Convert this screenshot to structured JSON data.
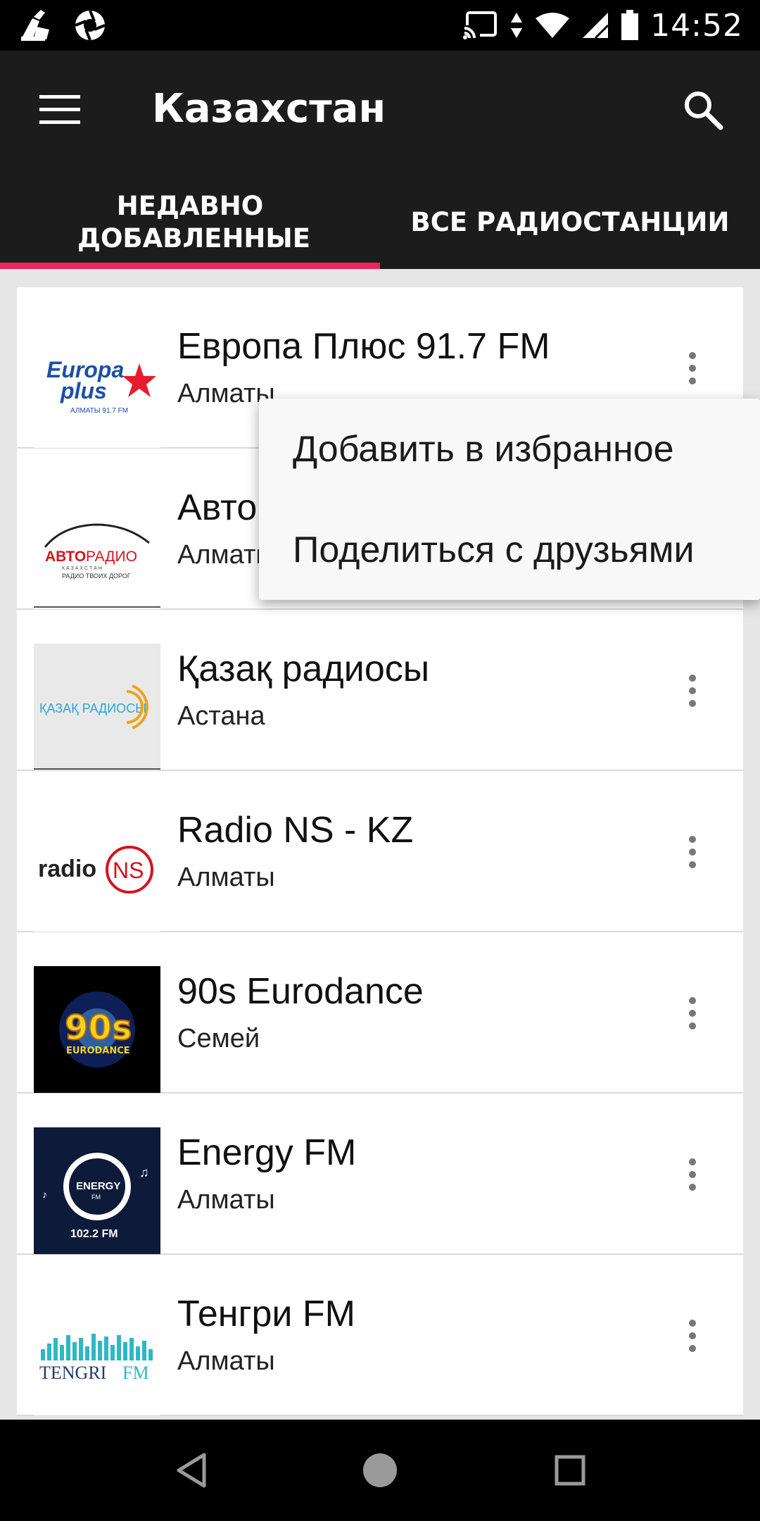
{
  "status": {
    "time": "14:52"
  },
  "app_bar": {
    "title": "Казахстан"
  },
  "tabs": [
    {
      "label": "НЕДАВНО ДОБАВЛЕННЫЕ",
      "active": true
    },
    {
      "label": "ВСЕ РАДИОСТАНЦИИ",
      "active": false
    }
  ],
  "stations": [
    {
      "name": "Европа Плюс 91.7 FM",
      "city": "Алматы",
      "logo": "europa-plus-logo"
    },
    {
      "name": "Авторадио",
      "city": "Алматы",
      "logo": "avtoradio-logo"
    },
    {
      "name": "Қазақ радиосы",
      "city": "Астана",
      "logo": "kazakh-radio-logo"
    },
    {
      "name": "Radio NS - KZ",
      "city": "Алматы",
      "logo": "radio-ns-logo"
    },
    {
      "name": "90s Eurodance",
      "city": "Семей",
      "logo": "90s-eurodance-logo"
    },
    {
      "name": "Energy FM",
      "city": "Алматы",
      "logo": "energy-fm-logo"
    },
    {
      "name": "Тенгри FM",
      "city": "Алматы",
      "logo": "tengri-fm-logo"
    }
  ],
  "logo_text": {
    "europa_1": "Europa",
    "europa_2": "plus",
    "europa_3": "АЛМАТЫ 91.7 FM",
    "avto_1": "АВТО",
    "avto_2": "РАДИО",
    "avto_3": "К А З А Х С Т А Н",
    "avto_4": "РАДИО ТВОИХ ДОРОГ",
    "kazakh": "ҚАЗАҚ РАДИОСЫ",
    "ns_1": "radio",
    "ns_2": "NS",
    "eurodance_1": "90s",
    "eurodance_2": "EURODANCE",
    "energy_1": "ENERGY",
    "energy_2": "FM",
    "energy_3": "102.2 FM",
    "tengri_1": "TENGRI",
    "tengri_2": "FM"
  },
  "popup_menu": [
    "Добавить в избранное",
    "Поделиться с друзьями"
  ],
  "colors": {
    "accent": "#e8265e",
    "app_bar": "#1c1c1c",
    "background": "#e6e6e6"
  }
}
